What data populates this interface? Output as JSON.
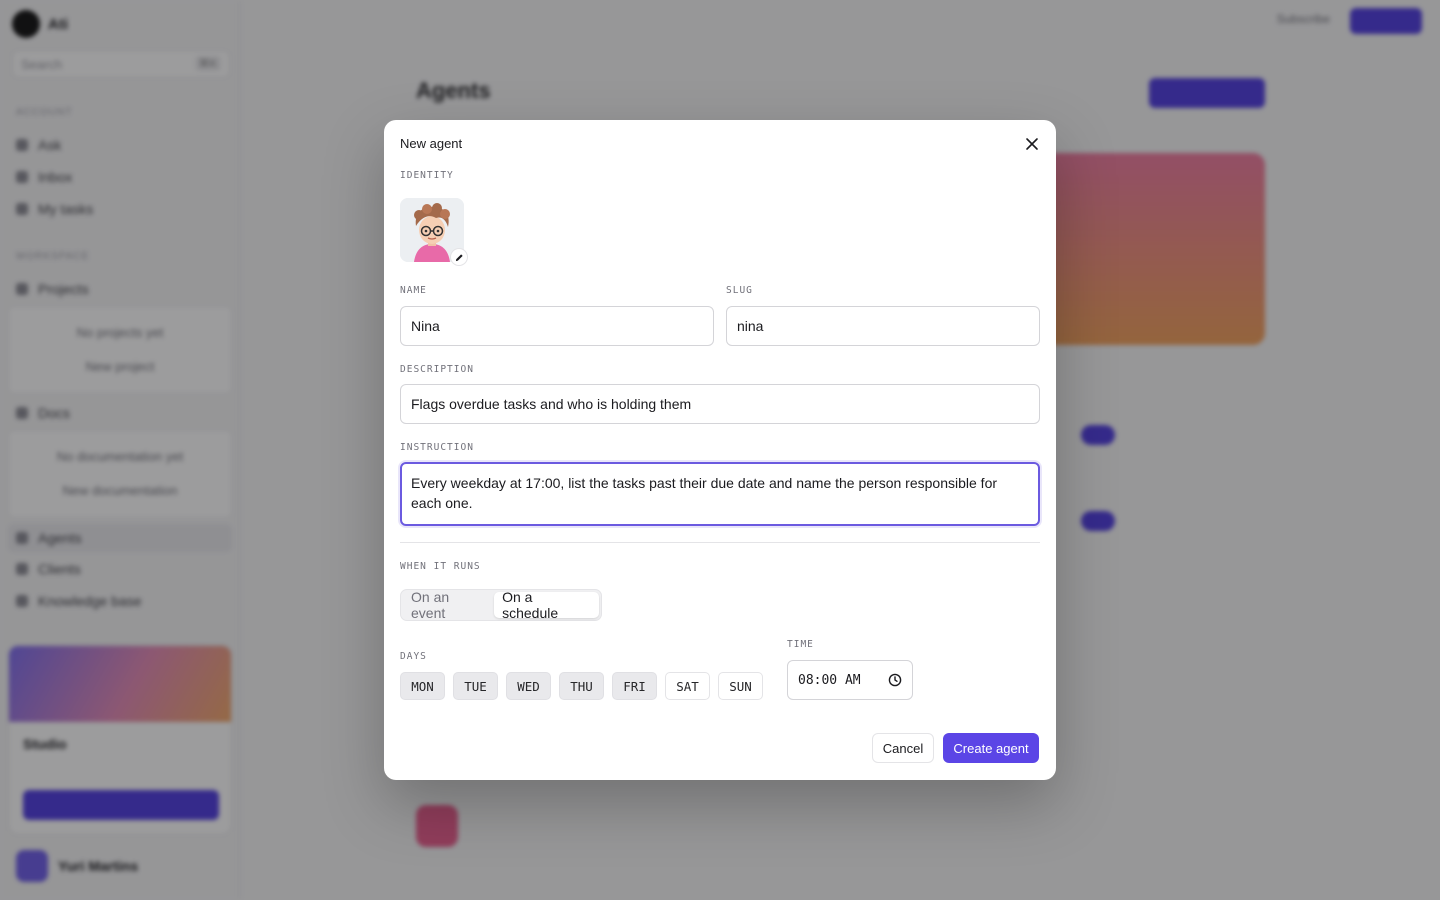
{
  "background": {
    "brand_name": "Ati",
    "search_placeholder": "Search",
    "search_kbd": "⌘K",
    "sections": {
      "account": "ACCOUNT",
      "workspace": "WORKSPACE"
    },
    "nav": [
      "Ask",
      "Inbox",
      "My tasks"
    ],
    "projects_label": "Projects",
    "projects_empty": "No projects yet",
    "projects_new": "New project",
    "docs_label": "Docs",
    "docs_empty": "No documentation yet",
    "docs_new": "New documentation",
    "nav2": [
      "Agents",
      "Clients",
      "Knowledge base"
    ],
    "studio_label": "Studio",
    "user_name": "Yuri Martins",
    "page_title": "Agents",
    "topbar_sub": "Subscribe"
  },
  "modal": {
    "title": "New agent",
    "sections": {
      "identity": "IDENTITY",
      "name": "NAME",
      "slug": "SLUG",
      "description": "DESCRIPTION",
      "instruction": "INSTRUCTION",
      "when_it_runs": "WHEN IT RUNS",
      "days": "DAYS",
      "time": "TIME"
    },
    "name_value": "Nina",
    "slug_value": "nina",
    "description_value": "Flags overdue tasks and who is holding them",
    "instruction_value": "Every weekday at 17:00, list the tasks past their due date and name the person responsible for each one.",
    "trigger_options": [
      {
        "label": "On an event",
        "selected": false
      },
      {
        "label": "On a schedule",
        "selected": true
      }
    ],
    "days": [
      {
        "label": "MON",
        "selected": true
      },
      {
        "label": "TUE",
        "selected": true
      },
      {
        "label": "WED",
        "selected": true
      },
      {
        "label": "THU",
        "selected": true
      },
      {
        "label": "FRI",
        "selected": true
      },
      {
        "label": "SAT",
        "selected": false
      },
      {
        "label": "SUN",
        "selected": false
      }
    ],
    "time_value": "08:00 AM",
    "cancel_label": "Cancel",
    "create_label": "Create agent",
    "icons": {
      "close": "close-icon",
      "edit": "pencil-icon",
      "clock": "clock-icon"
    },
    "accent_color": "#5b45e6"
  }
}
